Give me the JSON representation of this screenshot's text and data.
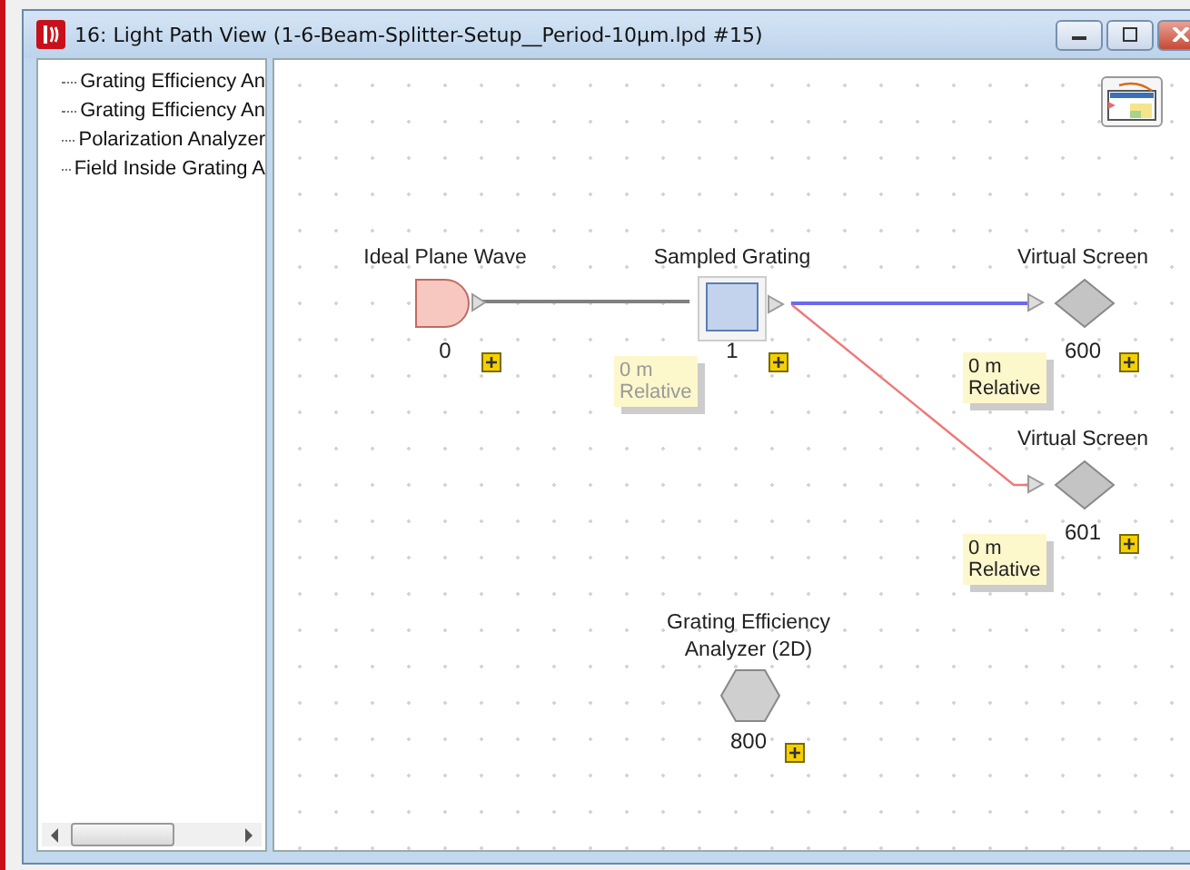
{
  "window": {
    "title": "16: Light Path View (1-6-Beam-Splitter-Setup__Period-10µm.lpd #15)"
  },
  "tree": {
    "items": [
      {
        "label": "Grating Efficiency An"
      },
      {
        "label": "Grating Efficiency An"
      },
      {
        "label": "Polarization Analyzer"
      },
      {
        "label": "Field Inside Grating A"
      }
    ]
  },
  "nodes": [
    {
      "kind": "source",
      "label": "Ideal Plane Wave",
      "id": "0"
    },
    {
      "kind": "component",
      "label": "Sampled Grating",
      "id": "1",
      "note": {
        "distance": "0 m",
        "mode": "Relative",
        "disabled": true
      }
    },
    {
      "kind": "detector",
      "label": "Virtual Screen",
      "id": "600",
      "note": {
        "distance": "0 m",
        "mode": "Relative",
        "disabled": false
      }
    },
    {
      "kind": "detector",
      "label": "Virtual Screen",
      "id": "601",
      "note": {
        "distance": "0 m",
        "mode": "Relative",
        "disabled": false
      }
    },
    {
      "kind": "analyzer",
      "label": "Grating Efficiency Analyzer (2D)",
      "id": "800"
    }
  ],
  "connections": [
    {
      "color": "#808080"
    },
    {
      "color": "#6a6af0"
    },
    {
      "color": "#f07878"
    }
  ]
}
